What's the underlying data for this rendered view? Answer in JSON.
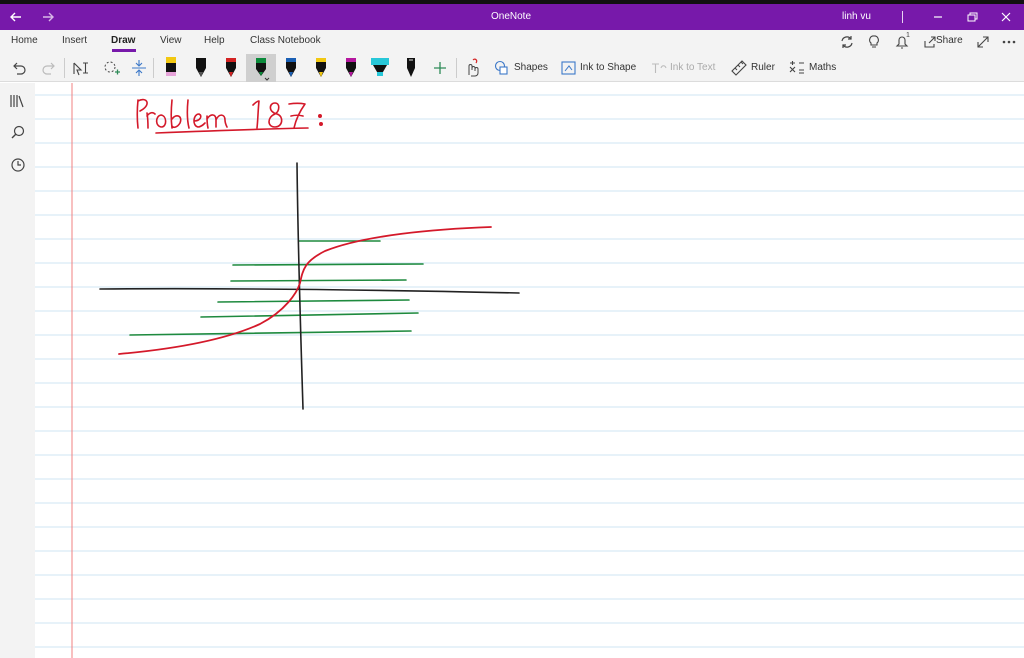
{
  "app": {
    "title": "OneNote",
    "user": "linh vu"
  },
  "menu": {
    "tabs": [
      "Home",
      "Insert",
      "Draw",
      "View",
      "Help",
      "Class Notebook"
    ],
    "active_tab": "Draw",
    "share_label": "Share",
    "notification_count": "1"
  },
  "toolbar": {
    "shapes_label": "Shapes",
    "ink_to_shape_label": "Ink to Shape",
    "ink_to_text_label": "Ink to Text",
    "ruler_label": "Ruler",
    "maths_label": "Maths",
    "pens": [
      {
        "name": "pen-pink",
        "color": "#e6a3d9"
      },
      {
        "name": "pen-black",
        "color": "#111111"
      },
      {
        "name": "pen-red",
        "color": "#d32222"
      },
      {
        "name": "pen-green",
        "color": "#0a8a3a"
      },
      {
        "name": "pen-blue",
        "color": "#1a5fb4"
      },
      {
        "name": "pen-yellow",
        "color": "#f2c811"
      },
      {
        "name": "pen-magenta",
        "color": "#b5179e"
      },
      {
        "name": "highlighter-cyan",
        "color": "#27c7d8"
      },
      {
        "name": "pen-black-2",
        "color": "#111111"
      }
    ],
    "selected_pen": "pen-green"
  },
  "note": {
    "handwritten_title": "Problem 187 :",
    "ink_colors": {
      "title": "#d4192a",
      "curve": "#d4192a",
      "axes": "#222222",
      "bars": "#1e8a3e"
    }
  },
  "colors": {
    "accent": "#7719aa",
    "rule_line": "#cfe6f3",
    "margin_line": "#f08080"
  }
}
